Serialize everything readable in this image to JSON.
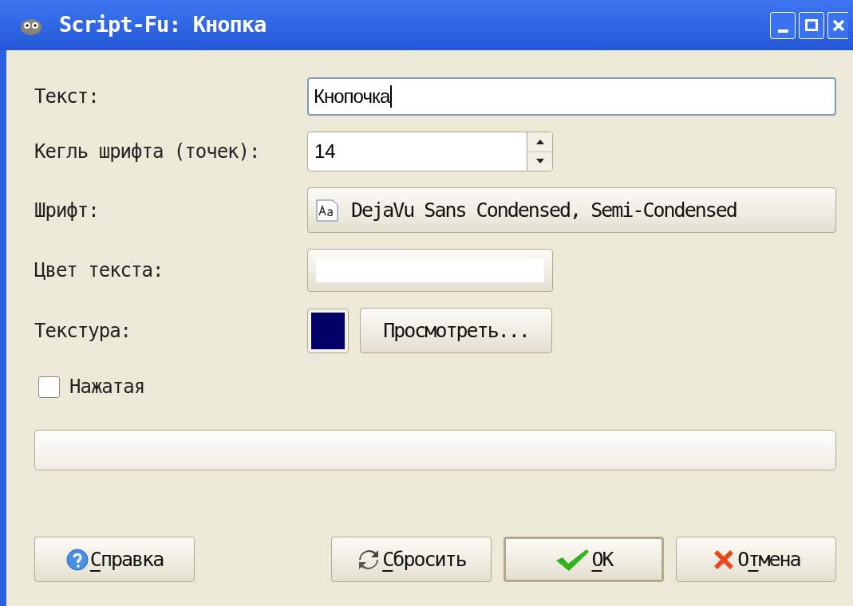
{
  "window": {
    "title": "Script-Fu: Кнопка"
  },
  "fields": {
    "text_label": "Текст:",
    "text_value": "Кнопочка",
    "size_label": "Кегль шрифта (точек):",
    "size_value": "14",
    "font_label": "Шрифт:",
    "font_value": "DejaVu Sans Condensed, Semi-Condensed",
    "color_label": "Цвет текста:",
    "color": "#ffffff",
    "texture_label": "Текстура:",
    "texture": {
      "color": "#000066"
    },
    "browse_button": "Просмотреть..."
  },
  "pressed": {
    "label": "Нажатая",
    "checked": false
  },
  "progress": {
    "level": 0
  },
  "buttons": [
    {
      "kind": "help",
      "key": "С",
      "post": "правка",
      "focused": false
    },
    {
      "kind": "reset",
      "key": "С",
      "post": "бросить",
      "focused": false
    },
    {
      "kind": "ok",
      "key": "O",
      "post": "K",
      "focused": true
    },
    {
      "kind": "cancel",
      "pre": "О",
      "key": "т",
      "post": "мена",
      "focused": false
    }
  ]
}
